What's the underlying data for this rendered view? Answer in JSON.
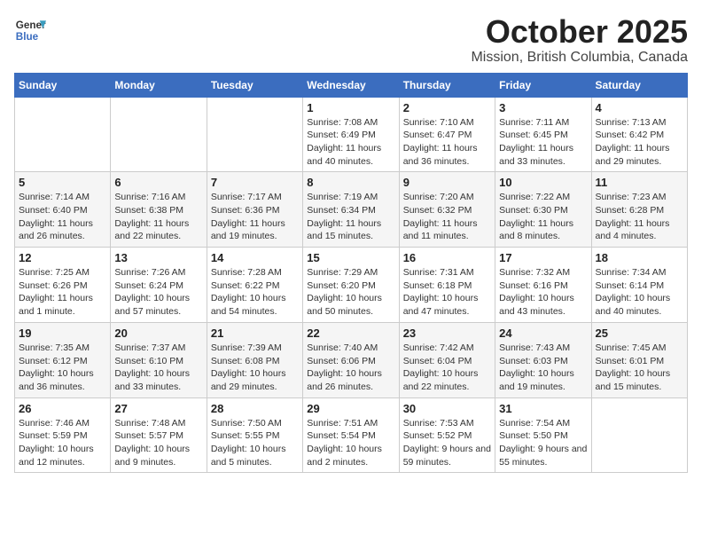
{
  "header": {
    "logo_line1": "General",
    "logo_line2": "Blue",
    "month": "October 2025",
    "location": "Mission, British Columbia, Canada"
  },
  "weekdays": [
    "Sunday",
    "Monday",
    "Tuesday",
    "Wednesday",
    "Thursday",
    "Friday",
    "Saturday"
  ],
  "weeks": [
    [
      {
        "day": "",
        "info": ""
      },
      {
        "day": "",
        "info": ""
      },
      {
        "day": "",
        "info": ""
      },
      {
        "day": "1",
        "info": "Sunrise: 7:08 AM\nSunset: 6:49 PM\nDaylight: 11 hours and 40 minutes."
      },
      {
        "day": "2",
        "info": "Sunrise: 7:10 AM\nSunset: 6:47 PM\nDaylight: 11 hours and 36 minutes."
      },
      {
        "day": "3",
        "info": "Sunrise: 7:11 AM\nSunset: 6:45 PM\nDaylight: 11 hours and 33 minutes."
      },
      {
        "day": "4",
        "info": "Sunrise: 7:13 AM\nSunset: 6:42 PM\nDaylight: 11 hours and 29 minutes."
      }
    ],
    [
      {
        "day": "5",
        "info": "Sunrise: 7:14 AM\nSunset: 6:40 PM\nDaylight: 11 hours and 26 minutes."
      },
      {
        "day": "6",
        "info": "Sunrise: 7:16 AM\nSunset: 6:38 PM\nDaylight: 11 hours and 22 minutes."
      },
      {
        "day": "7",
        "info": "Sunrise: 7:17 AM\nSunset: 6:36 PM\nDaylight: 11 hours and 19 minutes."
      },
      {
        "day": "8",
        "info": "Sunrise: 7:19 AM\nSunset: 6:34 PM\nDaylight: 11 hours and 15 minutes."
      },
      {
        "day": "9",
        "info": "Sunrise: 7:20 AM\nSunset: 6:32 PM\nDaylight: 11 hours and 11 minutes."
      },
      {
        "day": "10",
        "info": "Sunrise: 7:22 AM\nSunset: 6:30 PM\nDaylight: 11 hours and 8 minutes."
      },
      {
        "day": "11",
        "info": "Sunrise: 7:23 AM\nSunset: 6:28 PM\nDaylight: 11 hours and 4 minutes."
      }
    ],
    [
      {
        "day": "12",
        "info": "Sunrise: 7:25 AM\nSunset: 6:26 PM\nDaylight: 11 hours and 1 minute."
      },
      {
        "day": "13",
        "info": "Sunrise: 7:26 AM\nSunset: 6:24 PM\nDaylight: 10 hours and 57 minutes."
      },
      {
        "day": "14",
        "info": "Sunrise: 7:28 AM\nSunset: 6:22 PM\nDaylight: 10 hours and 54 minutes."
      },
      {
        "day": "15",
        "info": "Sunrise: 7:29 AM\nSunset: 6:20 PM\nDaylight: 10 hours and 50 minutes."
      },
      {
        "day": "16",
        "info": "Sunrise: 7:31 AM\nSunset: 6:18 PM\nDaylight: 10 hours and 47 minutes."
      },
      {
        "day": "17",
        "info": "Sunrise: 7:32 AM\nSunset: 6:16 PM\nDaylight: 10 hours and 43 minutes."
      },
      {
        "day": "18",
        "info": "Sunrise: 7:34 AM\nSunset: 6:14 PM\nDaylight: 10 hours and 40 minutes."
      }
    ],
    [
      {
        "day": "19",
        "info": "Sunrise: 7:35 AM\nSunset: 6:12 PM\nDaylight: 10 hours and 36 minutes."
      },
      {
        "day": "20",
        "info": "Sunrise: 7:37 AM\nSunset: 6:10 PM\nDaylight: 10 hours and 33 minutes."
      },
      {
        "day": "21",
        "info": "Sunrise: 7:39 AM\nSunset: 6:08 PM\nDaylight: 10 hours and 29 minutes."
      },
      {
        "day": "22",
        "info": "Sunrise: 7:40 AM\nSunset: 6:06 PM\nDaylight: 10 hours and 26 minutes."
      },
      {
        "day": "23",
        "info": "Sunrise: 7:42 AM\nSunset: 6:04 PM\nDaylight: 10 hours and 22 minutes."
      },
      {
        "day": "24",
        "info": "Sunrise: 7:43 AM\nSunset: 6:03 PM\nDaylight: 10 hours and 19 minutes."
      },
      {
        "day": "25",
        "info": "Sunrise: 7:45 AM\nSunset: 6:01 PM\nDaylight: 10 hours and 15 minutes."
      }
    ],
    [
      {
        "day": "26",
        "info": "Sunrise: 7:46 AM\nSunset: 5:59 PM\nDaylight: 10 hours and 12 minutes."
      },
      {
        "day": "27",
        "info": "Sunrise: 7:48 AM\nSunset: 5:57 PM\nDaylight: 10 hours and 9 minutes."
      },
      {
        "day": "28",
        "info": "Sunrise: 7:50 AM\nSunset: 5:55 PM\nDaylight: 10 hours and 5 minutes."
      },
      {
        "day": "29",
        "info": "Sunrise: 7:51 AM\nSunset: 5:54 PM\nDaylight: 10 hours and 2 minutes."
      },
      {
        "day": "30",
        "info": "Sunrise: 7:53 AM\nSunset: 5:52 PM\nDaylight: 9 hours and 59 minutes."
      },
      {
        "day": "31",
        "info": "Sunrise: 7:54 AM\nSunset: 5:50 PM\nDaylight: 9 hours and 55 minutes."
      },
      {
        "day": "",
        "info": ""
      }
    ]
  ]
}
